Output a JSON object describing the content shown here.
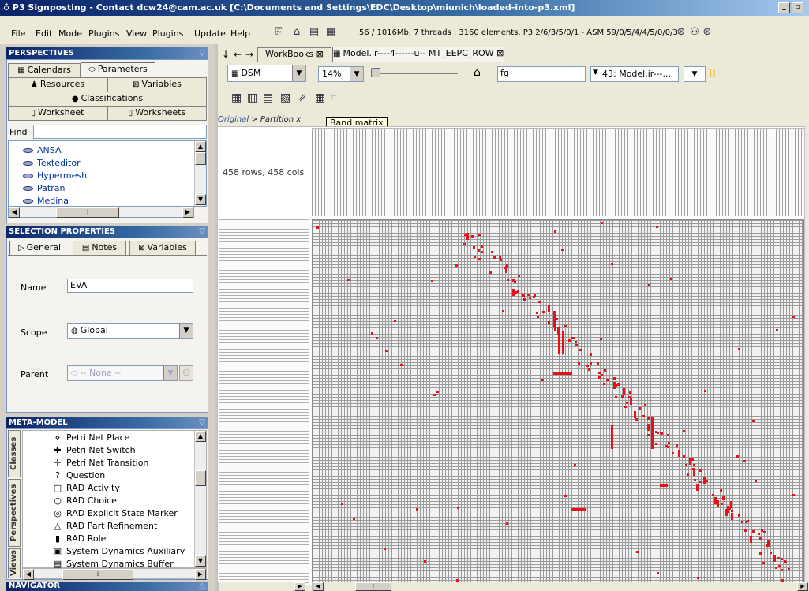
{
  "window": {
    "title": "P3 Signposting - Contact dcw24@cam.ac.uk [C:\\Documents and Settings\\EDC\\Desktop\\miunich\\loaded-into-p3.xml]",
    "min": "_",
    "max": "▫"
  },
  "menu": [
    "File",
    "Edit",
    "Mode",
    "Plugins",
    "View",
    "Plugins",
    "Update",
    "Help"
  ],
  "status_info": "56 / 1016Mb, 7 threads , 3160 elements, P3 2/6/3/5/0/1 - ASM 59/0/5/4/4/5/0/0/3",
  "perspectives": {
    "header": "PERSPECTIVES",
    "tabs": [
      "Calendars",
      "Parameters",
      "Resources",
      "Variables",
      "Classifications",
      "Worksheet",
      "Worksheets"
    ],
    "find_label": "Find",
    "find_value": "",
    "items": [
      "ANSA",
      "Texteditor",
      "Hypermesh",
      "Patran",
      "Medina"
    ]
  },
  "selection": {
    "header": "SELECTION PROPERTIES",
    "tabs": [
      "General",
      "Notes",
      "Variables"
    ],
    "name_label": "Name",
    "name_value": "EVA",
    "scope_label": "Scope",
    "scope_value": "Global",
    "parent_label": "Parent",
    "parent_value": "-- None --"
  },
  "metamodel": {
    "header": "META-MODEL",
    "side_tabs": [
      "Classes",
      "Perspectives",
      "Views"
    ],
    "items": [
      {
        "label": "Petri Net Place",
        "glyph": "⋄"
      },
      {
        "label": "Petri Net Switch",
        "glyph": "✚"
      },
      {
        "label": "Petri Net Transition",
        "glyph": "✛"
      },
      {
        "label": "Question",
        "glyph": "?"
      },
      {
        "label": "RAD Activity",
        "glyph": "□"
      },
      {
        "label": "RAD Choice",
        "glyph": "○"
      },
      {
        "label": "RAD Explicit State Marker",
        "glyph": "◎"
      },
      {
        "label": "RAD Part Refinement",
        "glyph": "△"
      },
      {
        "label": "RAD Role",
        "glyph": "▮"
      },
      {
        "label": "System Dynamics Auxiliary",
        "glyph": "▣"
      },
      {
        "label": "System Dynamics Buffer",
        "glyph": "▤"
      }
    ]
  },
  "navigator": {
    "header": "NAVIGATOR"
  },
  "editor": {
    "tabs": [
      "WorkBooks",
      "Model.ir----4------u-- MT_EEPC_ROW"
    ],
    "view_combo": "DSM",
    "zoom_combo": "14%",
    "filter_value": "fg",
    "model_combo": "43: Model.ir---...",
    "breadcrumb_original": "Original",
    "breadcrumb_sep": ">",
    "breadcrumb_partition": "Partition",
    "breadcrumb_close": "x",
    "tooltip": "Band matrix",
    "matrix_size": "458 rows, 458 cols"
  },
  "colors": {
    "mark": "#e8101c",
    "accent": "#0a246a"
  }
}
